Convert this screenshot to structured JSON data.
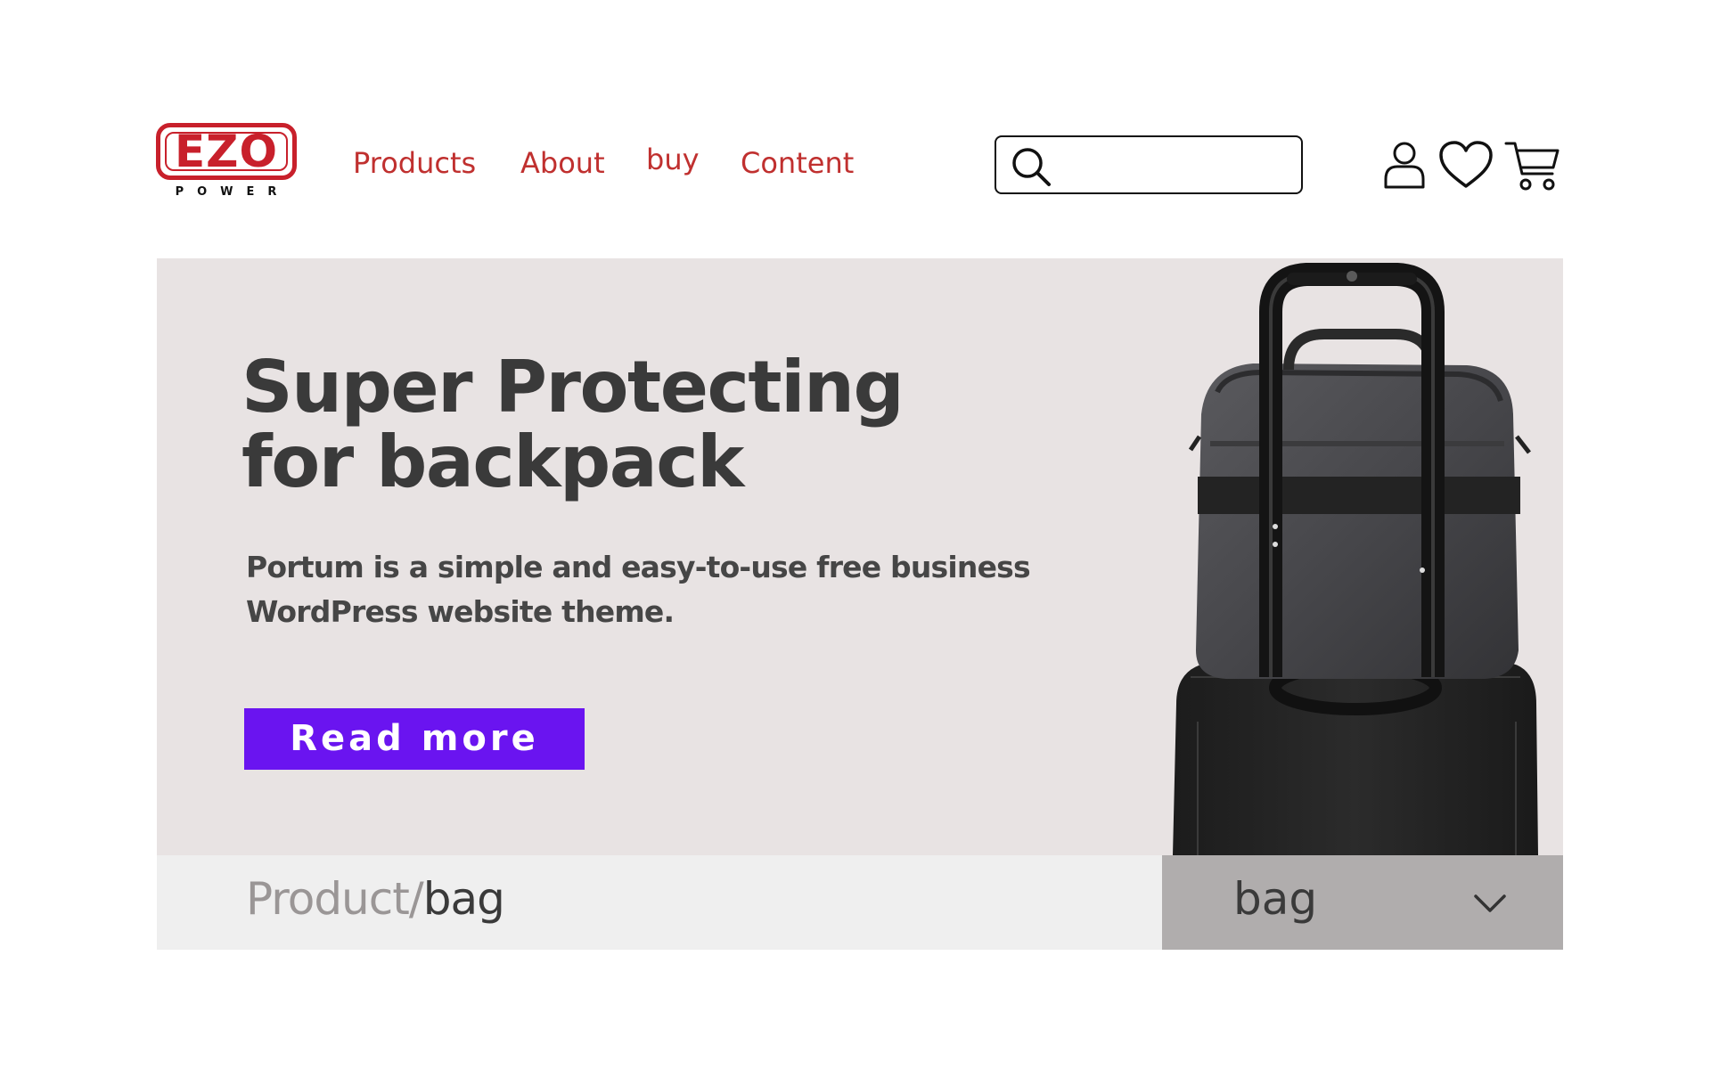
{
  "brand": {
    "logo_text": "EZO",
    "logo_subtext": "POWER"
  },
  "nav": {
    "items": [
      {
        "label": "Products"
      },
      {
        "label": "About"
      },
      {
        "label": "buy"
      },
      {
        "label": "Content"
      }
    ]
  },
  "search": {
    "value": "",
    "placeholder": ""
  },
  "header_icons": [
    "user-icon",
    "heart-icon",
    "cart-icon"
  ],
  "hero": {
    "title_line1": "Super Protecting",
    "title_line2": "for backpack",
    "description": "Portum is a simple and easy-to-use free business WordPress website theme.",
    "button_label": "Read more",
    "image": "laptop-bag-on-rolling-suitcase"
  },
  "breadcrumb": {
    "root": "Product",
    "separator": "/",
    "current": "bag"
  },
  "category_select": {
    "value": "bag",
    "icon": "chevron-down-icon"
  },
  "colors": {
    "brand_red": "#c8202b",
    "nav_red": "#c0302f",
    "button_purple": "#6a14f0",
    "hero_bg": "#e8e3e3",
    "crumb_bg": "#efefef",
    "select_bg": "#b0adad"
  }
}
